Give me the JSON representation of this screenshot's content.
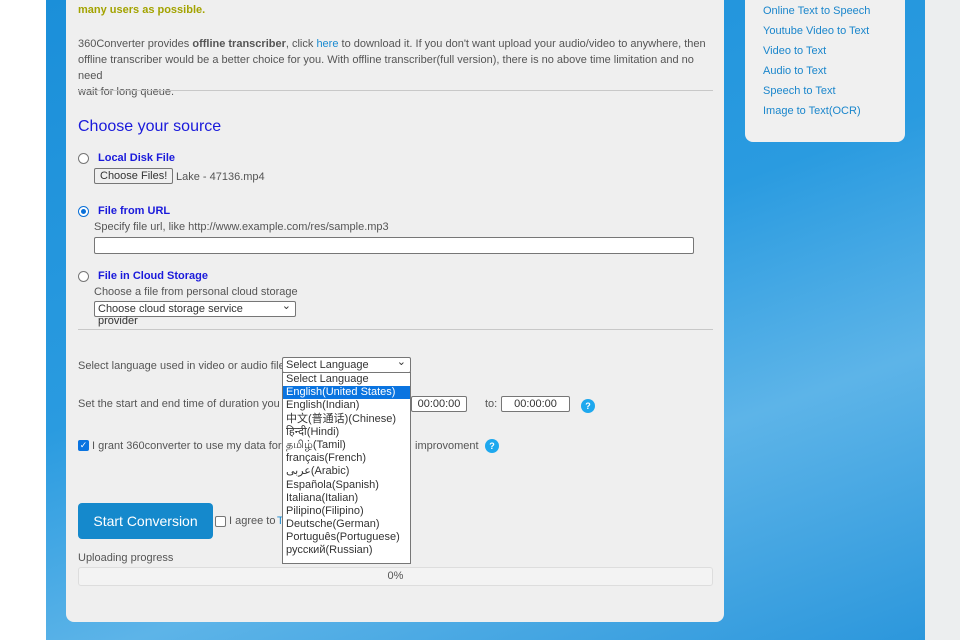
{
  "intro": {
    "highlight": "many users as possible.",
    "p_pre": "360Converter provides ",
    "p_bold": "offline transcriber",
    "p_mid": ", click ",
    "p_link": "here",
    "p_line1_rest": " to download it. If you don't want upload your audio/video to anywhere, then",
    "p_line2": "offline transcriber would be a better choice for you. With offline transcriber(full version), there is no above time limitation and no need",
    "p_line3": "wait for long queue."
  },
  "source": {
    "heading": "Choose your source",
    "local": {
      "label": "Local Disk File",
      "button": "Choose Files!",
      "file": "Lake - 47136.mp4",
      "selected": false
    },
    "url": {
      "label": "File from URL",
      "hint": "Specify file url, like http://www.example.com/res/sample.mp3",
      "value": "",
      "selected": true
    },
    "cloud": {
      "label": "File in Cloud Storage",
      "hint": "Choose a file from personal cloud storage",
      "select": "Choose cloud storage service provider",
      "selected": false
    }
  },
  "language": {
    "label": "Select language used in video or audio file",
    "selected": "Select Language",
    "options": [
      "Select Language",
      "English(United States)",
      "English(Indian)",
      "中文(普通话)(Chinese)",
      "हिन्दी(Hindi)",
      "தமிழ்(Tamil)",
      "français(French)",
      "عربى(Arabic)",
      "Española(Spanish)",
      "Italiana(Italian)",
      "Pilipino(Filipino)",
      "Deutsche(German)",
      "Português(Portuguese)",
      "русский(Russian)"
    ],
    "highlighted_index": 1
  },
  "duration": {
    "label": "Set the start and end time of duration you w",
    "start": "00:00:00",
    "to_label": "to:",
    "end": "00:00:00"
  },
  "grant": {
    "label": "I grant 360converter to use my data for f",
    "label_tail": "improvoment",
    "checked": true
  },
  "start_button": "Start Conversion",
  "agree": {
    "label": "I agree to",
    "link": "T",
    "checked": false
  },
  "progress": {
    "label": "Uploading progress",
    "value": "0%",
    "fraction": 0
  },
  "sidebar": {
    "links": [
      "Online Text to Speech",
      "Youtube Video to Text",
      "Video to Text",
      "Audio to Text",
      "Speech to Text",
      "Image to Text(OCR)"
    ]
  }
}
